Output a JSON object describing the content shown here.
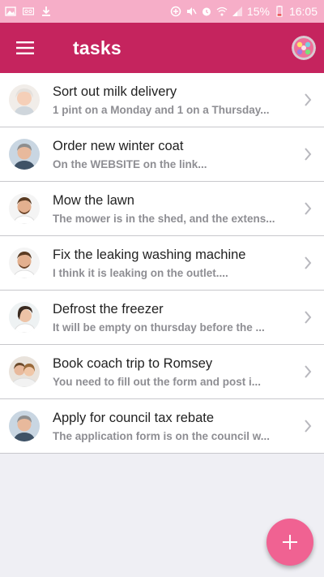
{
  "status_bar": {
    "battery_percent": "15%",
    "time": "16:05",
    "icons": [
      "gallery-icon",
      "voicemail-icon",
      "download-icon",
      "data-saver-icon",
      "mute-icon",
      "alarm-icon",
      "wifi-icon",
      "signal-icon",
      "battery-icon"
    ]
  },
  "app_bar": {
    "title": "tasks",
    "menu_icon": "hamburger-icon",
    "avatar_icon": "user-avatar-icon"
  },
  "tasks": [
    {
      "title": "Sort out milk delivery",
      "subtitle": "1 pint on a Monday and 1 on a Thursday...",
      "avatar": "elderly-woman"
    },
    {
      "title": "Order new winter coat",
      "subtitle": "On the WEBSITE on the link...",
      "avatar": "man-grey-hair"
    },
    {
      "title": "Mow the lawn",
      "subtitle": "The mower is in the shed, and the extens...",
      "avatar": "young-man-beard"
    },
    {
      "title": "Fix the leaking washing machine",
      "subtitle": "I think it is leaking on the outlet....",
      "avatar": "young-man-beard"
    },
    {
      "title": "Defrost the freezer",
      "subtitle": "It will be empty on thursday before the ...",
      "avatar": "woman-dark-hair"
    },
    {
      "title": "Book coach trip to Romsey",
      "subtitle": "You need to fill out the form and post i...",
      "avatar": "couple"
    },
    {
      "title": "Apply for council tax rebate",
      "subtitle": "The application form is on the council w...",
      "avatar": "man-grey-hair"
    }
  ],
  "fab": {
    "icon": "plus-icon"
  },
  "colors": {
    "status_bar": "#f6aec8",
    "app_bar": "#c5245e",
    "fab": "#f06292",
    "background": "#efeff4"
  }
}
